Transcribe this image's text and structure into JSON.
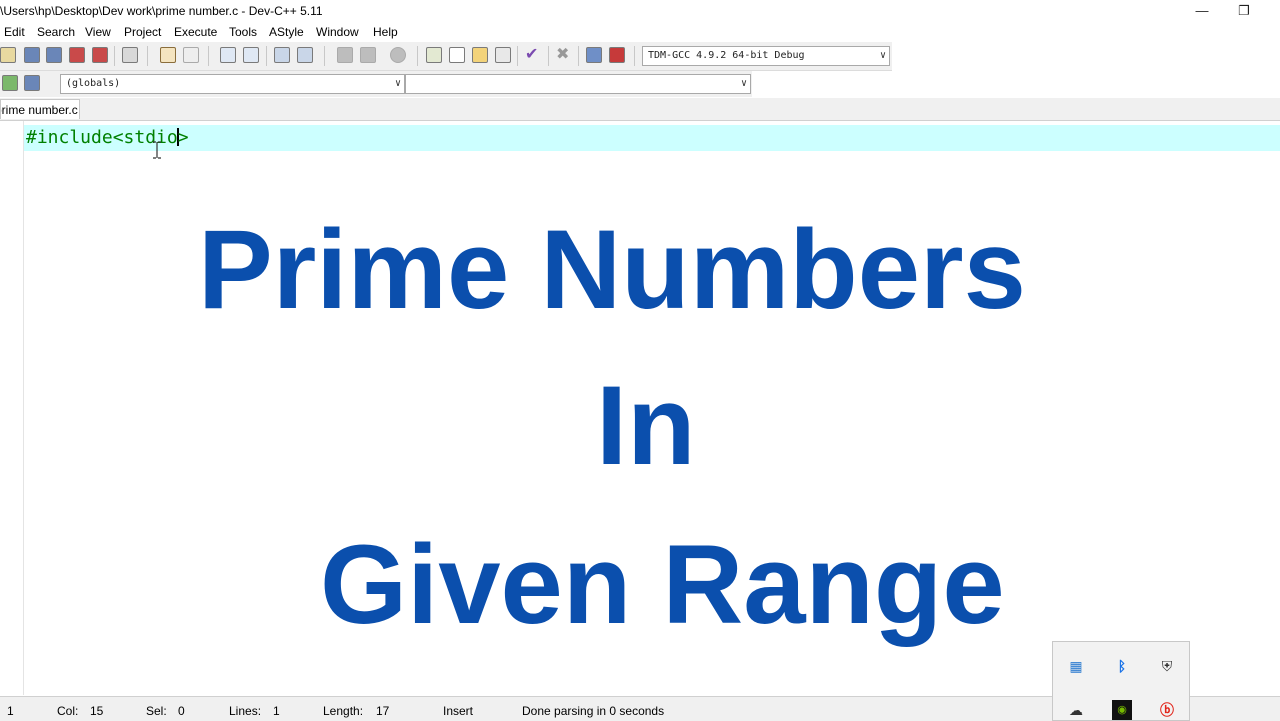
{
  "window": {
    "title": "\\Users\\hp\\Desktop\\Dev work\\prime number.c - Dev-C++ 5.11",
    "minimize_glyph": "—",
    "restore_glyph": "❐"
  },
  "menu": [
    "Edit",
    "Search",
    "View",
    "Project",
    "Execute",
    "Tools",
    "AStyle",
    "Window",
    "Help"
  ],
  "toolbar": {
    "compiler_select": "TDM-GCC 4.9.2 64-bit Debug",
    "scope_select": "(globals)",
    "member_select": ""
  },
  "tab": {
    "label": "prime number.c"
  },
  "editor": {
    "code_before_caret": "#include<stdio",
    "code_after_caret": ">",
    "current_line_color": "#ccffff",
    "code_color": "#008000"
  },
  "overlay": {
    "line1": "Prime Numbers",
    "line2": "In",
    "line3": "Given Range",
    "color": "#0b4fad"
  },
  "status": {
    "line": "1",
    "col_label": "Col:",
    "col_value": "15",
    "sel_label": "Sel:",
    "sel_value": "0",
    "lines_label": "Lines:",
    "lines_value": "1",
    "length_label": "Length:",
    "length_value": "17",
    "mode": "Insert",
    "message": "Done parsing in 0 seconds"
  },
  "tray": {
    "icons": [
      "network-icon",
      "bluetooth-icon",
      "security-shield-icon",
      "cloud-off-icon",
      "nvidia-icon",
      "beats-icon"
    ]
  }
}
